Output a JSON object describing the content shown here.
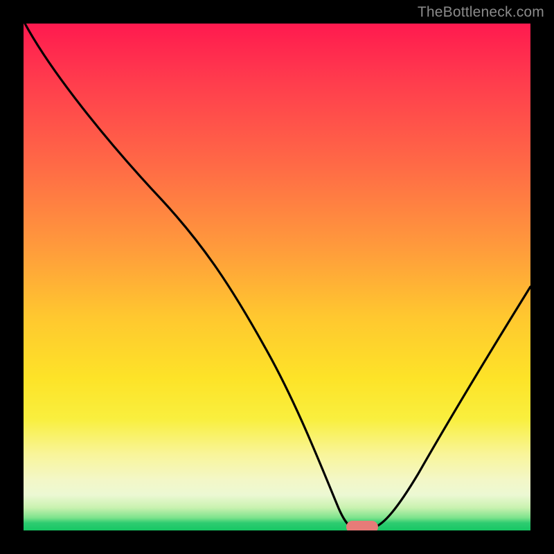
{
  "watermark": {
    "text": "TheBottleneck.com"
  },
  "chart_data": {
    "type": "line",
    "title": "",
    "xlabel": "",
    "ylabel": "",
    "xlim": [
      0,
      100
    ],
    "ylim": [
      0,
      100
    ],
    "grid": false,
    "legend": false,
    "series": [
      {
        "name": "bottleneck-curve",
        "x": [
          0,
          6,
          12,
          18,
          24,
          30,
          36,
          42,
          48,
          54,
          58,
          62,
          65,
          68,
          72,
          78,
          84,
          90,
          96,
          100
        ],
        "y": [
          100,
          93,
          85,
          78,
          71,
          60,
          48,
          36,
          24,
          12,
          5,
          1,
          0,
          0,
          3,
          12,
          23,
          34,
          45,
          52
        ]
      }
    ],
    "marker": {
      "x": 66,
      "y": 0.7,
      "w": 6,
      "h": 2.4,
      "color": "#e77b78"
    },
    "gradient_stops": [
      {
        "pos": 0.0,
        "color": "#ff1a4f"
      },
      {
        "pos": 0.5,
        "color": "#ffc82f"
      },
      {
        "pos": 0.85,
        "color": "#f9f59a"
      },
      {
        "pos": 0.98,
        "color": "#2ecc71"
      },
      {
        "pos": 1.0,
        "color": "#17c764"
      }
    ]
  }
}
